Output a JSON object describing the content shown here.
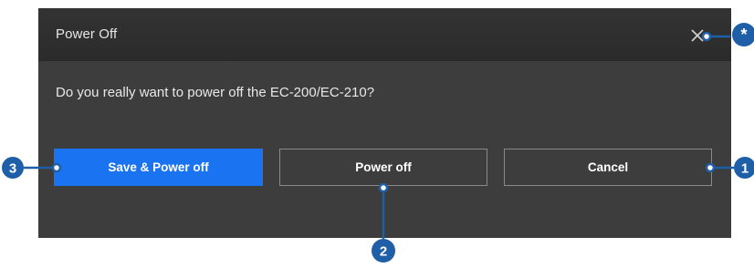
{
  "dialog": {
    "title": "Power Off",
    "message": "Do you really want to power off the EC-200/EC-210?",
    "close_icon": "close-icon"
  },
  "buttons": {
    "save_power_off": "Save & Power off",
    "power_off": "Power off",
    "cancel": "Cancel"
  },
  "callouts": {
    "close": "*",
    "cancel": "1",
    "power_off": "2",
    "save_power_off": "3"
  },
  "colors": {
    "primary_button": "#1a73f0",
    "callout": "#1f5fa8",
    "dialog_body": "#3d3d3d",
    "title_bar": "#2f2f2f"
  }
}
